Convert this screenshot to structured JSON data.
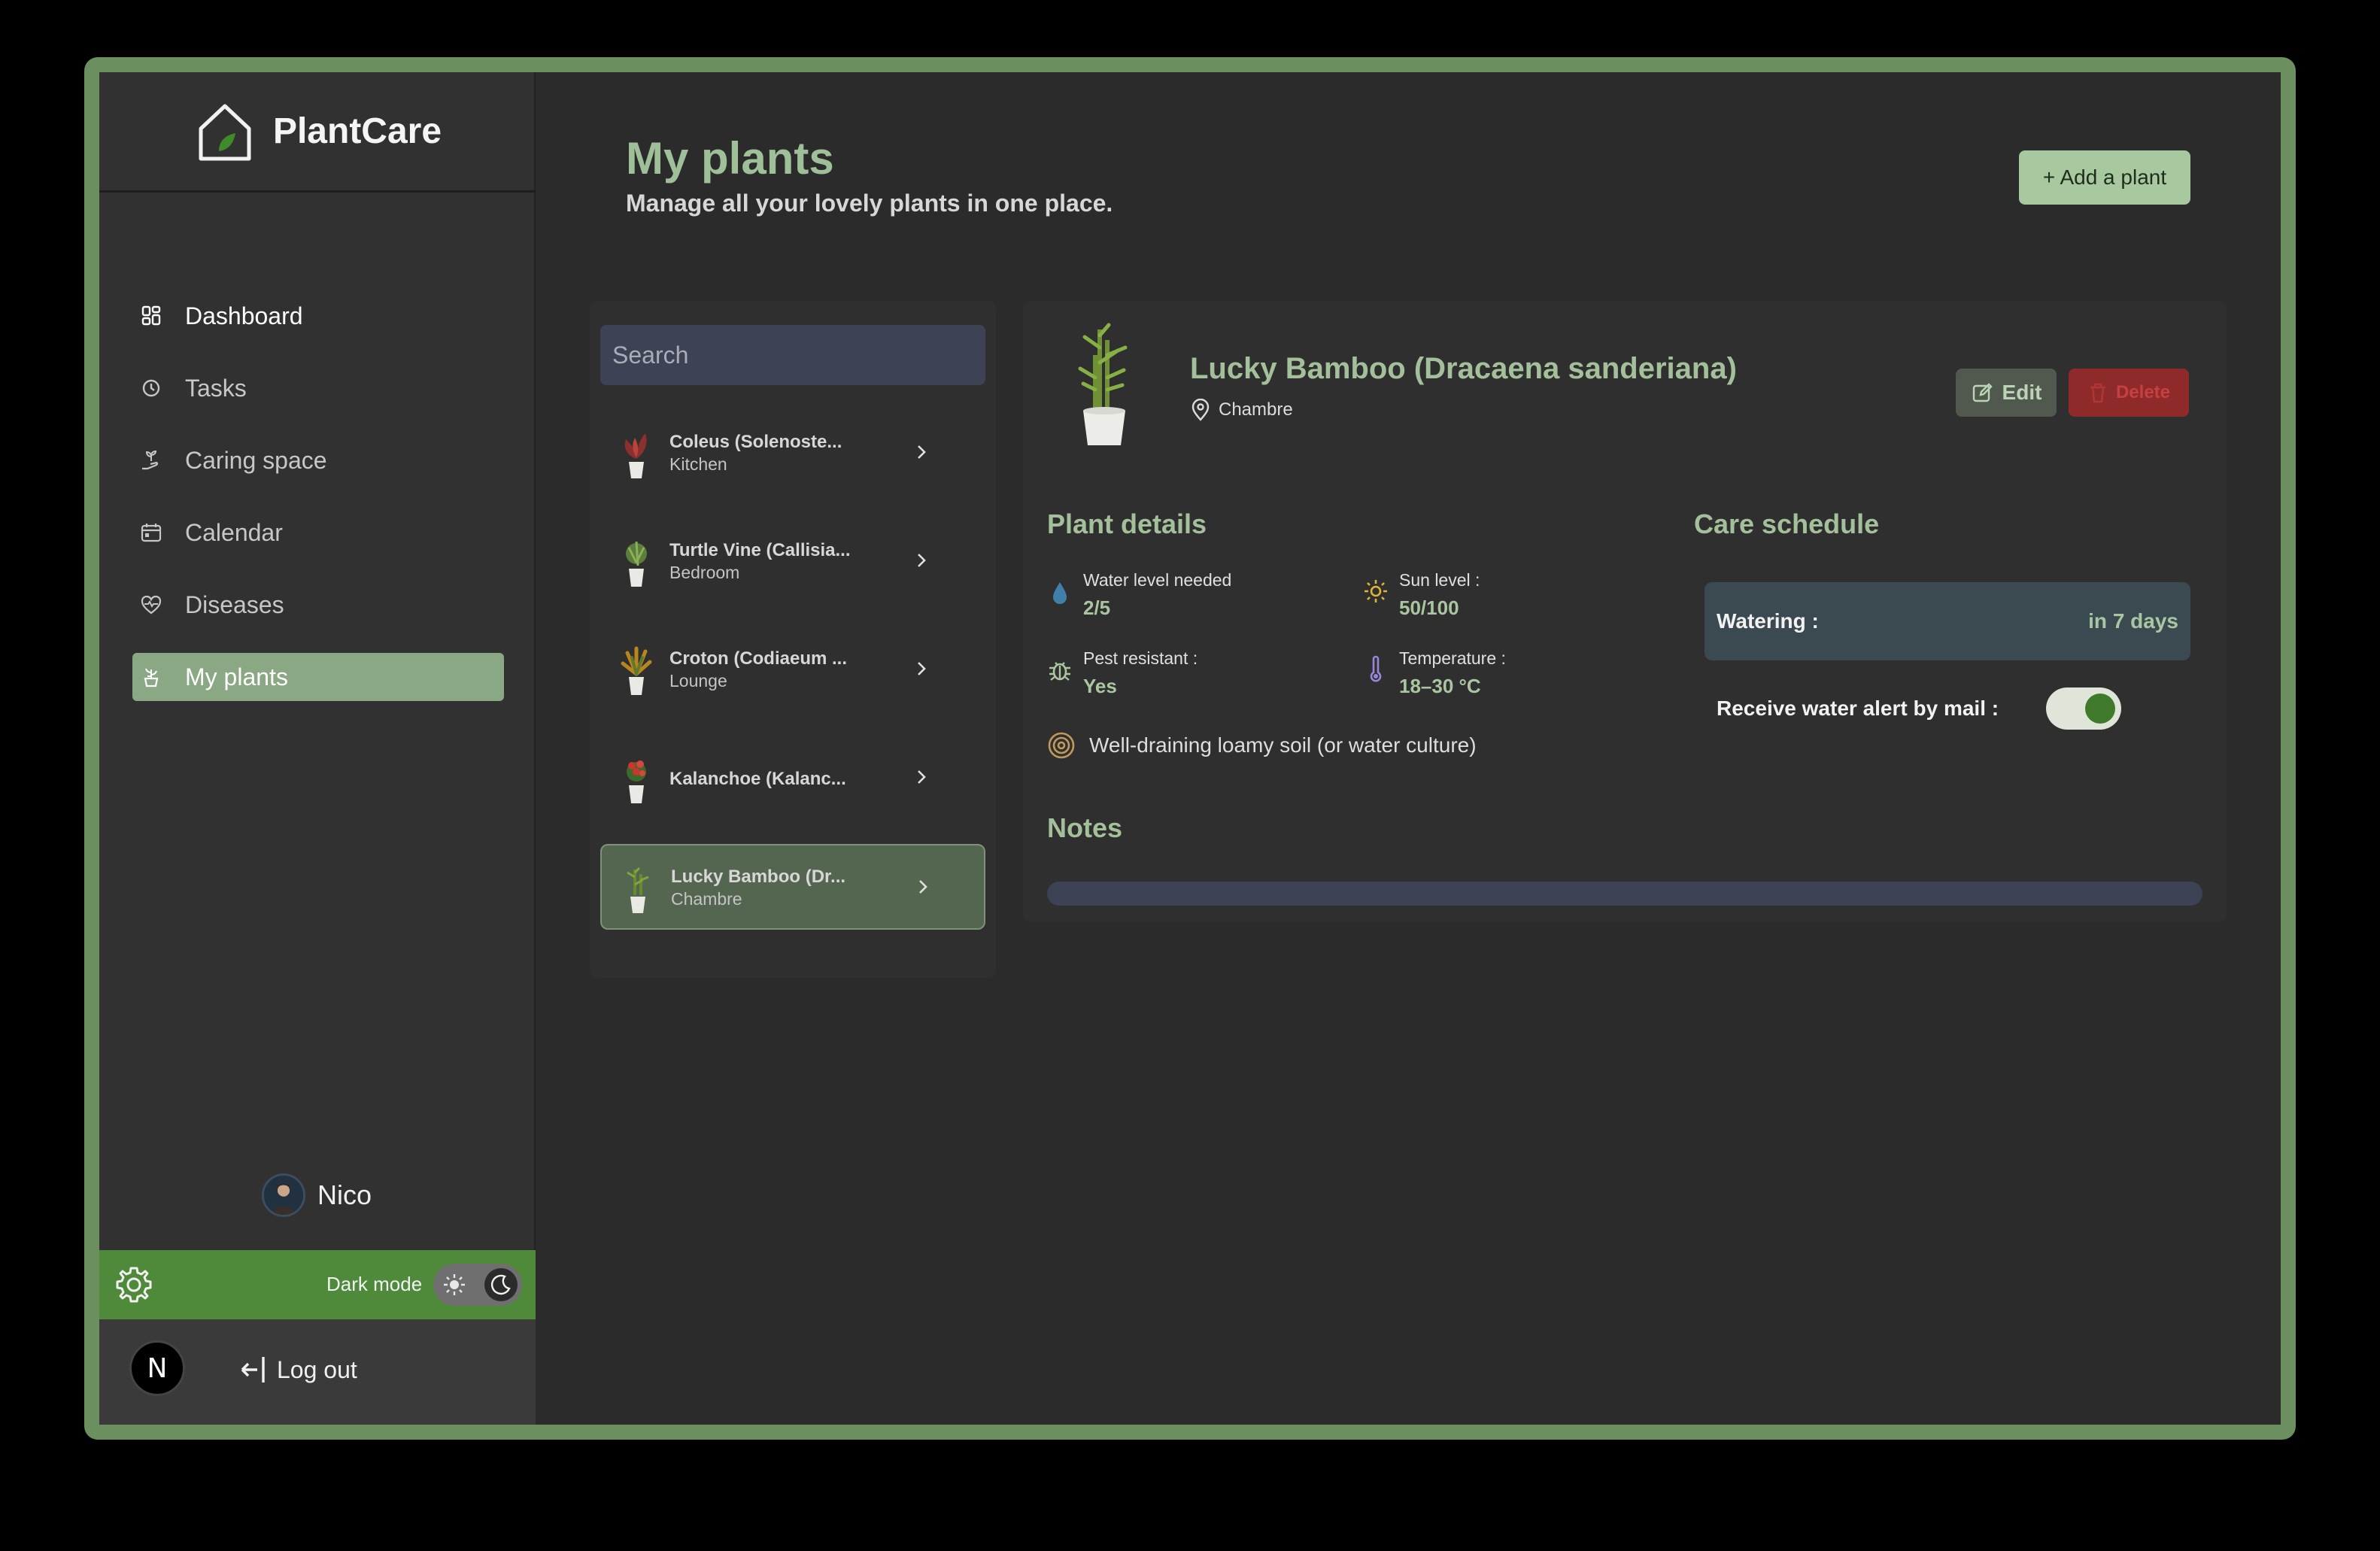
{
  "brand": {
    "name": "PlantCare"
  },
  "nav": [
    {
      "label": "Dashboard"
    },
    {
      "label": "Tasks"
    },
    {
      "label": "Caring space"
    },
    {
      "label": "Calendar"
    },
    {
      "label": "Diseases"
    },
    {
      "label": "My plants"
    }
  ],
  "user": {
    "name": "Nico"
  },
  "mode": {
    "label": "Dark mode"
  },
  "footer": {
    "badge": "N",
    "logout": "Log out"
  },
  "page": {
    "title": "My plants",
    "subtitle": "Manage all your lovely plants in one place.",
    "add_button": "+ Add a plant"
  },
  "search": {
    "placeholder": "Search"
  },
  "plants": [
    {
      "name": "Coleus (Solenoste...",
      "room": "Kitchen"
    },
    {
      "name": "Turtle Vine (Callisia...",
      "room": "Bedroom"
    },
    {
      "name": "Croton (Codiaeum ...",
      "room": "Lounge"
    },
    {
      "name": "Kalanchoe (Kalanc...",
      "room": ""
    },
    {
      "name": "Lucky Bamboo (Dr...",
      "room": "Chambre"
    }
  ],
  "detail": {
    "title": "Lucky Bamboo (Dracaena sanderiana)",
    "location": "Chambre",
    "edit": "Edit",
    "delete": "Delete",
    "plant_details_title": "Plant details",
    "water_label": "Water level needed",
    "water_value": "2/5",
    "sun_label": "Sun level :",
    "sun_value": "50/100",
    "pest_label": "Pest resistant :",
    "pest_value": "Yes",
    "temp_label": "Temperature :",
    "temp_value": "18–30 °C",
    "soil": "Well-draining loamy soil (or water culture)",
    "care_title": "Care schedule",
    "watering_label": "Watering :",
    "watering_value": "in 7 days",
    "alert_label": "Receive water alert by mail :",
    "alert_enabled": true,
    "notes_title": "Notes"
  },
  "colors": {
    "accent": "#9fbf98",
    "frame": "#6b8f5f",
    "active_nav": "#8aa883",
    "mode_bar": "#4e8a3a"
  }
}
